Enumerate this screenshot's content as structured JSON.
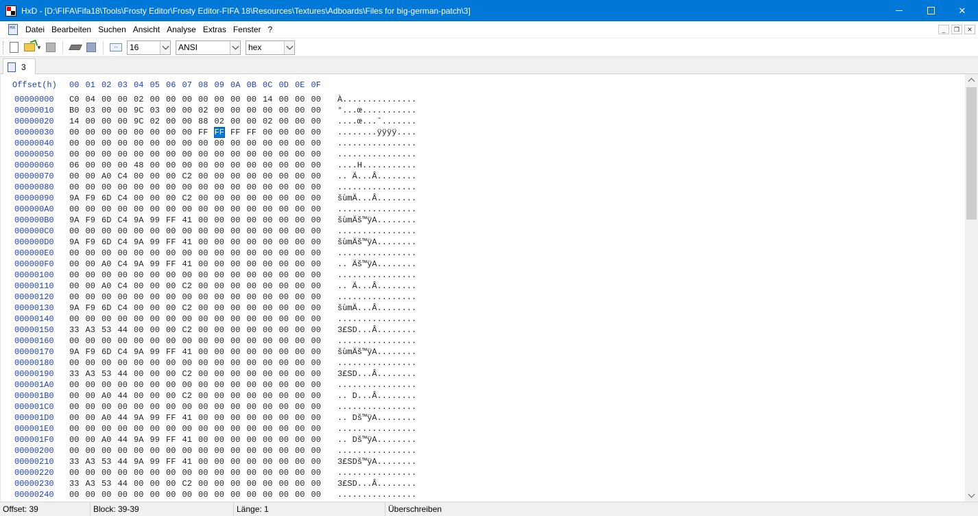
{
  "window": {
    "app_name": "HxD",
    "title": "HxD - [D:\\FIFA\\Fifa18\\Tools\\Frosty Editor\\Frosty Editor-FIFA 18\\Resources\\Textures\\Adboards\\Files for big-german-patch\\3]",
    "icons": [
      "hxd-app-icon",
      "minimize-icon",
      "maximize-icon",
      "close-icon"
    ]
  },
  "menu": {
    "items": [
      "Datei",
      "Bearbeiten",
      "Suchen",
      "Ansicht",
      "Analyse",
      "Extras",
      "Fenster",
      "?"
    ]
  },
  "toolbar": {
    "bytes_per_row": "16",
    "charset": "ANSI",
    "offset_base": "hex",
    "icons": [
      "new-file-icon",
      "open-folder-icon",
      "save-icon",
      "open-ram-icon",
      "open-disk-icon",
      "bytes-per-row-icon"
    ]
  },
  "tabs": [
    {
      "label": "3"
    }
  ],
  "editor": {
    "header_label": "Offset(h)",
    "columns": [
      "00",
      "01",
      "02",
      "03",
      "04",
      "05",
      "06",
      "07",
      "08",
      "09",
      "0A",
      "0B",
      "0C",
      "0D",
      "0E",
      "0F"
    ],
    "selected_offset": "39",
    "rows": [
      {
        "offset": "00000000",
        "bytes": [
          "C0",
          "04",
          "00",
          "00",
          "02",
          "00",
          "00",
          "00",
          "00",
          "00",
          "00",
          "00",
          "14",
          "00",
          "00",
          "00"
        ],
        "text": "À..............."
      },
      {
        "offset": "00000010",
        "bytes": [
          "B0",
          "03",
          "00",
          "00",
          "9C",
          "03",
          "00",
          "00",
          "02",
          "00",
          "00",
          "00",
          "00",
          "00",
          "00",
          "00"
        ],
        "text": "°...œ..........."
      },
      {
        "offset": "00000020",
        "bytes": [
          "14",
          "00",
          "00",
          "00",
          "9C",
          "02",
          "00",
          "00",
          "88",
          "02",
          "00",
          "00",
          "02",
          "00",
          "00",
          "00"
        ],
        "text": "....œ...ˆ......."
      },
      {
        "offset": "00000030",
        "bytes": [
          "00",
          "00",
          "00",
          "00",
          "00",
          "00",
          "00",
          "00",
          "FF",
          "FF",
          "FF",
          "FF",
          "00",
          "00",
          "00",
          "00"
        ],
        "text": "........ÿÿÿÿ...."
      },
      {
        "offset": "00000040",
        "bytes": [
          "00",
          "00",
          "00",
          "00",
          "00",
          "00",
          "00",
          "00",
          "00",
          "00",
          "00",
          "00",
          "00",
          "00",
          "00",
          "00"
        ],
        "text": "................"
      },
      {
        "offset": "00000050",
        "bytes": [
          "00",
          "00",
          "00",
          "00",
          "00",
          "00",
          "00",
          "00",
          "00",
          "00",
          "00",
          "00",
          "00",
          "00",
          "00",
          "00"
        ],
        "text": "................"
      },
      {
        "offset": "00000060",
        "bytes": [
          "06",
          "00",
          "00",
          "00",
          "48",
          "00",
          "00",
          "00",
          "00",
          "00",
          "00",
          "00",
          "00",
          "00",
          "00",
          "00"
        ],
        "text": "....H..........."
      },
      {
        "offset": "00000070",
        "bytes": [
          "00",
          "00",
          "A0",
          "C4",
          "00",
          "00",
          "00",
          "C2",
          "00",
          "00",
          "00",
          "00",
          "00",
          "00",
          "00",
          "00"
        ],
        "text": ".. Ä...Â........"
      },
      {
        "offset": "00000080",
        "bytes": [
          "00",
          "00",
          "00",
          "00",
          "00",
          "00",
          "00",
          "00",
          "00",
          "00",
          "00",
          "00",
          "00",
          "00",
          "00",
          "00"
        ],
        "text": "................"
      },
      {
        "offset": "00000090",
        "bytes": [
          "9A",
          "F9",
          "6D",
          "C4",
          "00",
          "00",
          "00",
          "C2",
          "00",
          "00",
          "00",
          "00",
          "00",
          "00",
          "00",
          "00"
        ],
        "text": "šùmÄ...Â........"
      },
      {
        "offset": "000000A0",
        "bytes": [
          "00",
          "00",
          "00",
          "00",
          "00",
          "00",
          "00",
          "00",
          "00",
          "00",
          "00",
          "00",
          "00",
          "00",
          "00",
          "00"
        ],
        "text": "................"
      },
      {
        "offset": "000000B0",
        "bytes": [
          "9A",
          "F9",
          "6D",
          "C4",
          "9A",
          "99",
          "FF",
          "41",
          "00",
          "00",
          "00",
          "00",
          "00",
          "00",
          "00",
          "00"
        ],
        "text": "šùmÄš™ÿA........"
      },
      {
        "offset": "000000C0",
        "bytes": [
          "00",
          "00",
          "00",
          "00",
          "00",
          "00",
          "00",
          "00",
          "00",
          "00",
          "00",
          "00",
          "00",
          "00",
          "00",
          "00"
        ],
        "text": "................"
      },
      {
        "offset": "000000D0",
        "bytes": [
          "9A",
          "F9",
          "6D",
          "C4",
          "9A",
          "99",
          "FF",
          "41",
          "00",
          "00",
          "00",
          "00",
          "00",
          "00",
          "00",
          "00"
        ],
        "text": "šùmÄš™ÿA........"
      },
      {
        "offset": "000000E0",
        "bytes": [
          "00",
          "00",
          "00",
          "00",
          "00",
          "00",
          "00",
          "00",
          "00",
          "00",
          "00",
          "00",
          "00",
          "00",
          "00",
          "00"
        ],
        "text": "................"
      },
      {
        "offset": "000000F0",
        "bytes": [
          "00",
          "00",
          "A0",
          "C4",
          "9A",
          "99",
          "FF",
          "41",
          "00",
          "00",
          "00",
          "00",
          "00",
          "00",
          "00",
          "00"
        ],
        "text": ".. Äš™ÿA........"
      },
      {
        "offset": "00000100",
        "bytes": [
          "00",
          "00",
          "00",
          "00",
          "00",
          "00",
          "00",
          "00",
          "00",
          "00",
          "00",
          "00",
          "00",
          "00",
          "00",
          "00"
        ],
        "text": "................"
      },
      {
        "offset": "00000110",
        "bytes": [
          "00",
          "00",
          "A0",
          "C4",
          "00",
          "00",
          "00",
          "C2",
          "00",
          "00",
          "00",
          "00",
          "00",
          "00",
          "00",
          "00"
        ],
        "text": ".. Ä...Â........"
      },
      {
        "offset": "00000120",
        "bytes": [
          "00",
          "00",
          "00",
          "00",
          "00",
          "00",
          "00",
          "00",
          "00",
          "00",
          "00",
          "00",
          "00",
          "00",
          "00",
          "00"
        ],
        "text": "................"
      },
      {
        "offset": "00000130",
        "bytes": [
          "9A",
          "F9",
          "6D",
          "C4",
          "00",
          "00",
          "00",
          "C2",
          "00",
          "00",
          "00",
          "00",
          "00",
          "00",
          "00",
          "00"
        ],
        "text": "šùmÄ...Â........"
      },
      {
        "offset": "00000140",
        "bytes": [
          "00",
          "00",
          "00",
          "00",
          "00",
          "00",
          "00",
          "00",
          "00",
          "00",
          "00",
          "00",
          "00",
          "00",
          "00",
          "00"
        ],
        "text": "................"
      },
      {
        "offset": "00000150",
        "bytes": [
          "33",
          "A3",
          "53",
          "44",
          "00",
          "00",
          "00",
          "C2",
          "00",
          "00",
          "00",
          "00",
          "00",
          "00",
          "00",
          "00"
        ],
        "text": "3£SD...Â........"
      },
      {
        "offset": "00000160",
        "bytes": [
          "00",
          "00",
          "00",
          "00",
          "00",
          "00",
          "00",
          "00",
          "00",
          "00",
          "00",
          "00",
          "00",
          "00",
          "00",
          "00"
        ],
        "text": "................"
      },
      {
        "offset": "00000170",
        "bytes": [
          "9A",
          "F9",
          "6D",
          "C4",
          "9A",
          "99",
          "FF",
          "41",
          "00",
          "00",
          "00",
          "00",
          "00",
          "00",
          "00",
          "00"
        ],
        "text": "šùmÄš™ÿA........"
      },
      {
        "offset": "00000180",
        "bytes": [
          "00",
          "00",
          "00",
          "00",
          "00",
          "00",
          "00",
          "00",
          "00",
          "00",
          "00",
          "00",
          "00",
          "00",
          "00",
          "00"
        ],
        "text": "................"
      },
      {
        "offset": "00000190",
        "bytes": [
          "33",
          "A3",
          "53",
          "44",
          "00",
          "00",
          "00",
          "C2",
          "00",
          "00",
          "00",
          "00",
          "00",
          "00",
          "00",
          "00"
        ],
        "text": "3£SD...Â........"
      },
      {
        "offset": "000001A0",
        "bytes": [
          "00",
          "00",
          "00",
          "00",
          "00",
          "00",
          "00",
          "00",
          "00",
          "00",
          "00",
          "00",
          "00",
          "00",
          "00",
          "00"
        ],
        "text": "................"
      },
      {
        "offset": "000001B0",
        "bytes": [
          "00",
          "00",
          "A0",
          "44",
          "00",
          "00",
          "00",
          "C2",
          "00",
          "00",
          "00",
          "00",
          "00",
          "00",
          "00",
          "00"
        ],
        "text": ".. D...Â........"
      },
      {
        "offset": "000001C0",
        "bytes": [
          "00",
          "00",
          "00",
          "00",
          "00",
          "00",
          "00",
          "00",
          "00",
          "00",
          "00",
          "00",
          "00",
          "00",
          "00",
          "00"
        ],
        "text": "................"
      },
      {
        "offset": "000001D0",
        "bytes": [
          "00",
          "00",
          "A0",
          "44",
          "9A",
          "99",
          "FF",
          "41",
          "00",
          "00",
          "00",
          "00",
          "00",
          "00",
          "00",
          "00"
        ],
        "text": ".. Dš™ÿA........"
      },
      {
        "offset": "000001E0",
        "bytes": [
          "00",
          "00",
          "00",
          "00",
          "00",
          "00",
          "00",
          "00",
          "00",
          "00",
          "00",
          "00",
          "00",
          "00",
          "00",
          "00"
        ],
        "text": "................"
      },
      {
        "offset": "000001F0",
        "bytes": [
          "00",
          "00",
          "A0",
          "44",
          "9A",
          "99",
          "FF",
          "41",
          "00",
          "00",
          "00",
          "00",
          "00",
          "00",
          "00",
          "00"
        ],
        "text": ".. Dš™ÿA........"
      },
      {
        "offset": "00000200",
        "bytes": [
          "00",
          "00",
          "00",
          "00",
          "00",
          "00",
          "00",
          "00",
          "00",
          "00",
          "00",
          "00",
          "00",
          "00",
          "00",
          "00"
        ],
        "text": "................"
      },
      {
        "offset": "00000210",
        "bytes": [
          "33",
          "A3",
          "53",
          "44",
          "9A",
          "99",
          "FF",
          "41",
          "00",
          "00",
          "00",
          "00",
          "00",
          "00",
          "00",
          "00"
        ],
        "text": "3£SDš™ÿA........"
      },
      {
        "offset": "00000220",
        "bytes": [
          "00",
          "00",
          "00",
          "00",
          "00",
          "00",
          "00",
          "00",
          "00",
          "00",
          "00",
          "00",
          "00",
          "00",
          "00",
          "00"
        ],
        "text": "................"
      },
      {
        "offset": "00000230",
        "bytes": [
          "33",
          "A3",
          "53",
          "44",
          "00",
          "00",
          "00",
          "C2",
          "00",
          "00",
          "00",
          "00",
          "00",
          "00",
          "00",
          "00"
        ],
        "text": "3£SD...Â........"
      },
      {
        "offset": "00000240",
        "bytes": [
          "00",
          "00",
          "00",
          "00",
          "00",
          "00",
          "00",
          "00",
          "00",
          "00",
          "00",
          "00",
          "00",
          "00",
          "00",
          "00"
        ],
        "text": "................"
      }
    ]
  },
  "statusbar": {
    "offset": "Offset: 39",
    "block": "Block: 39-39",
    "length": "Länge: 1",
    "mode": "Überschreiben"
  },
  "colors": {
    "titlebar": "#0078d7",
    "offset_text": "#1f3fbf",
    "selection": "#0078d7"
  }
}
